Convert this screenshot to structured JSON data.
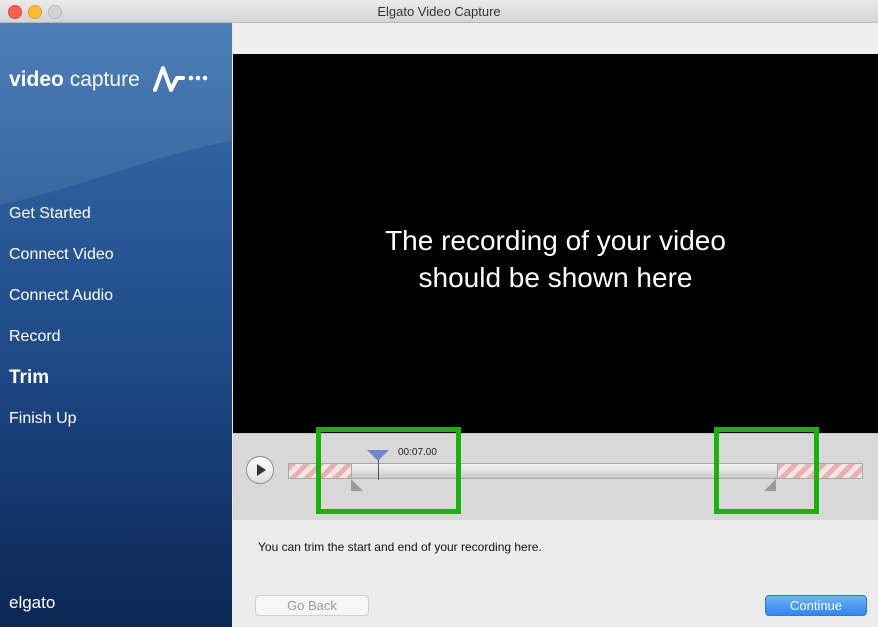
{
  "window": {
    "title": "Elgato Video Capture"
  },
  "sidebar": {
    "logo": {
      "bold": "video",
      "light": "capture"
    },
    "steps": [
      {
        "label": "Get Started"
      },
      {
        "label": "Connect Video"
      },
      {
        "label": "Connect Audio"
      },
      {
        "label": "Record"
      },
      {
        "label": "Trim",
        "active": true
      },
      {
        "label": "Finish Up"
      }
    ],
    "brand": "elgato"
  },
  "video": {
    "message_line1": "The recording of your video",
    "message_line2": "should be shown here"
  },
  "trim": {
    "playhead_time": "00:07.00"
  },
  "instructions": "You can trim the start and end of your recording here.",
  "buttons": {
    "back": "Go Back",
    "continue": "Continue"
  },
  "colors": {
    "accent": "#2f86f0",
    "highlight": "#17b20e",
    "sidebar_top": "#3d74b3",
    "sidebar_bottom": "#0c2753"
  }
}
